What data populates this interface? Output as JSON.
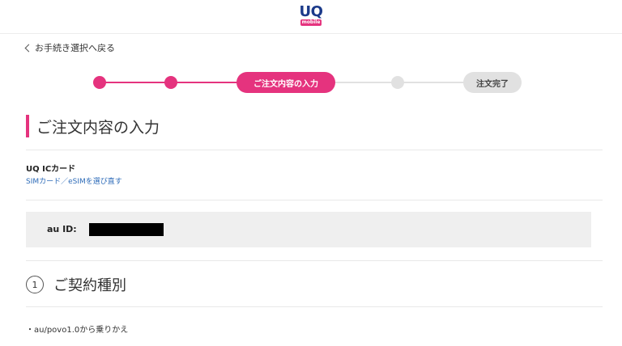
{
  "header": {
    "logo_text": "UQ",
    "logo_sub": "mobile"
  },
  "back_link": {
    "label": "お手続き選択へ戻る",
    "icon": "chevron-left-icon"
  },
  "stepper": {
    "current_label": "ご注文内容の入力",
    "final_label": "注文完了",
    "current_step": 3,
    "total_steps": 5,
    "accent_color": "#e5337e",
    "inactive_color": "#e1e1e1"
  },
  "section": {
    "title": "ご注文内容の入力"
  },
  "product": {
    "name": "UQ ICカード",
    "change_link": "SIMカード／eSIMを選び直す"
  },
  "account": {
    "label": "au ID:"
  },
  "contract": {
    "number": "1",
    "title": "ご契約種別",
    "option": "・au/povo1.0から乗りかえ"
  }
}
